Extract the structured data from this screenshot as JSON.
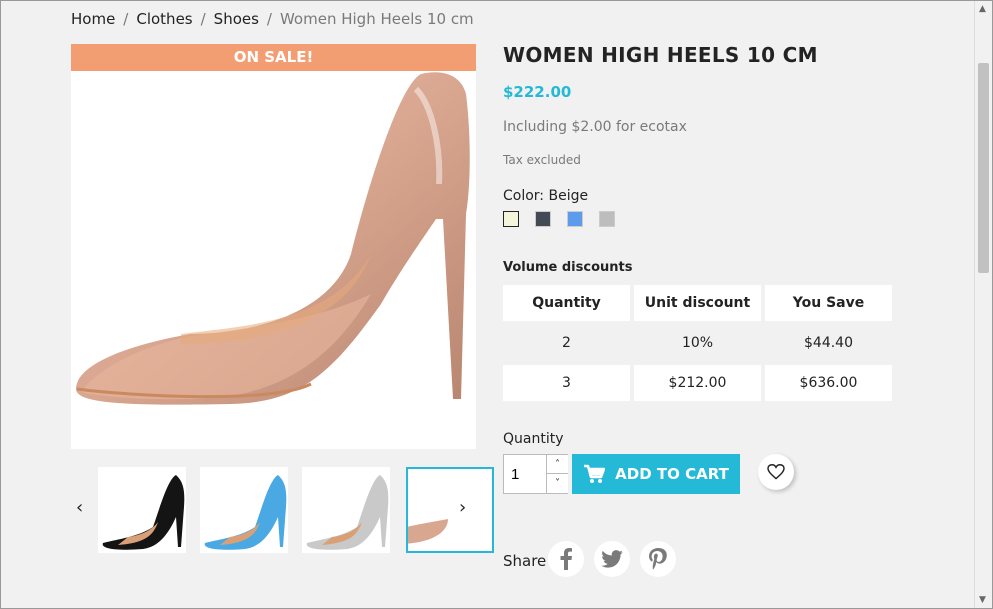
{
  "breadcrumb": {
    "items": [
      "Home",
      "Clothes",
      "Shoes"
    ],
    "separator": "/",
    "current": "Women High Heels 10 cm"
  },
  "product": {
    "sale_banner": "ON SALE!",
    "title": "WOMEN HIGH HEELS 10 CM",
    "price": "$222.00",
    "ecotax": "Including $2.00 for ecotax",
    "tax_note": "Tax excluded",
    "color_label": "Color: Beige",
    "colors": [
      {
        "name": "Beige",
        "hex": "#f5f5dc",
        "selected": true
      },
      {
        "name": "Grey",
        "hex": "#434a54",
        "selected": false
      },
      {
        "name": "Blue",
        "hex": "#5d9cec",
        "selected": false
      },
      {
        "name": "Silver",
        "hex": "#bdbdbd",
        "selected": false
      }
    ],
    "main_color": "#d9a78f"
  },
  "thumbnails": [
    {
      "color": "black",
      "selected": false
    },
    {
      "color": "blue",
      "selected": false
    },
    {
      "color": "silver",
      "selected": false
    },
    {
      "color": "beige",
      "selected": true
    }
  ],
  "volume_discounts": {
    "label": "Volume discounts",
    "headers": [
      "Quantity",
      "Unit discount",
      "You Save"
    ],
    "rows": [
      [
        "2",
        "10%",
        "$44.40"
      ],
      [
        "3",
        "$212.00",
        "$636.00"
      ]
    ]
  },
  "quantity": {
    "label": "Quantity",
    "value": "1"
  },
  "buttons": {
    "add_to_cart": "ADD TO CART"
  },
  "share": {
    "label": "Share",
    "networks": [
      "facebook",
      "twitter",
      "pinterest"
    ]
  },
  "colors": {
    "accent": "#24b9d7",
    "sale": "#f39d72"
  }
}
